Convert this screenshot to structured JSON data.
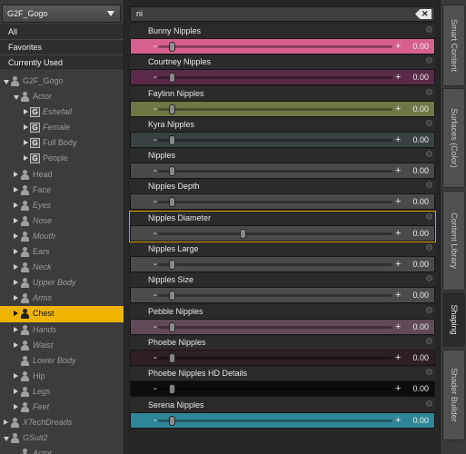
{
  "figure_selector": {
    "value": "G2F_Gogo"
  },
  "filters": [
    "All",
    "Favorites",
    "Currently Used"
  ],
  "tree": [
    {
      "label": "G2F_Gogo",
      "depth": 0,
      "icon": "person-icon",
      "expander": "down",
      "style": "dim"
    },
    {
      "label": "Actor",
      "depth": 1,
      "icon": "person-icon",
      "expander": "down",
      "style": "dim"
    },
    {
      "label": "Eshefail",
      "depth": 2,
      "icon": "group-icon",
      "expander": "right",
      "style": "ital"
    },
    {
      "label": "Female",
      "depth": 2,
      "icon": "group-icon",
      "expander": "right",
      "style": "ital"
    },
    {
      "label": "Full Body",
      "depth": 2,
      "icon": "group-icon",
      "expander": "right",
      "style": "dim"
    },
    {
      "label": "People",
      "depth": 2,
      "icon": "group-icon",
      "expander": "right",
      "style": "dim"
    },
    {
      "label": "Head",
      "depth": 1,
      "icon": "person-icon",
      "expander": "right",
      "style": "dim"
    },
    {
      "label": "Face",
      "depth": 1,
      "icon": "person-icon",
      "expander": "right",
      "style": "dim"
    },
    {
      "label": "Eyes",
      "depth": 1,
      "icon": "person-icon",
      "expander": "right",
      "style": "ital"
    },
    {
      "label": "Nose",
      "depth": 1,
      "icon": "person-icon",
      "expander": "right",
      "style": "ital"
    },
    {
      "label": "Mouth",
      "depth": 1,
      "icon": "person-icon",
      "expander": "right",
      "style": "ital"
    },
    {
      "label": "Ears",
      "depth": 1,
      "icon": "person-icon",
      "expander": "right",
      "style": "dim"
    },
    {
      "label": "Neck",
      "depth": 1,
      "icon": "person-icon",
      "expander": "right",
      "style": "ital"
    },
    {
      "label": "Upper Body",
      "depth": 1,
      "icon": "person-icon",
      "expander": "right",
      "style": "ital"
    },
    {
      "label": "Arms",
      "depth": 1,
      "icon": "person-icon",
      "expander": "right",
      "style": "ital"
    },
    {
      "label": "Chest",
      "depth": 1,
      "icon": "person-icon",
      "expander": "right",
      "style": "sel"
    },
    {
      "label": "Hands",
      "depth": 1,
      "icon": "person-icon",
      "expander": "right",
      "style": "ital"
    },
    {
      "label": "Waist",
      "depth": 1,
      "icon": "person-icon",
      "expander": "right",
      "style": "ital"
    },
    {
      "label": "Lower Body",
      "depth": 1,
      "icon": "person-icon",
      "expander": "",
      "style": "ital"
    },
    {
      "label": "Hip",
      "depth": 1,
      "icon": "person-icon",
      "expander": "right",
      "style": "dim"
    },
    {
      "label": "Legs",
      "depth": 1,
      "icon": "person-icon",
      "expander": "right",
      "style": "ital"
    },
    {
      "label": "Feet",
      "depth": 1,
      "icon": "person-icon",
      "expander": "right",
      "style": "ital"
    },
    {
      "label": "XTechDreads",
      "depth": 0,
      "icon": "person-icon",
      "expander": "right",
      "style": "ital"
    },
    {
      "label": "GSuit2",
      "depth": 0,
      "icon": "person-icon",
      "expander": "down",
      "style": "ital"
    },
    {
      "label": "Actor",
      "depth": 1,
      "icon": "person-icon",
      "expander": "",
      "style": "ital"
    }
  ],
  "search": {
    "value": "ni"
  },
  "sliders": [
    {
      "name": "Bunny Nipples",
      "value": "0.00",
      "color": "#d8608f",
      "knob": 0.06,
      "active": false
    },
    {
      "name": "Courtney Nipples",
      "value": "0.00",
      "color": "#5a2a48",
      "knob": 0.06,
      "active": false
    },
    {
      "name": "Faylinn Nipples",
      "value": "0.00",
      "color": "#6e7846",
      "knob": 0.06,
      "active": false
    },
    {
      "name": "Kyra Nipples",
      "value": "0.00",
      "color": "#3a4143",
      "knob": 0.06,
      "active": false
    },
    {
      "name": "Nipples",
      "value": "0.00",
      "color": "#4a4a4a",
      "knob": 0.06,
      "active": false
    },
    {
      "name": "Nipples Depth",
      "value": "0.00",
      "color": "#4a4a4a",
      "knob": 0.06,
      "active": false
    },
    {
      "name": "Nipples Diameter",
      "value": "0.00",
      "color": "#4a4a4a",
      "knob": 0.36,
      "active": true
    },
    {
      "name": "Nipples Large",
      "value": "0.00",
      "color": "#4a4a4a",
      "knob": 0.06,
      "active": false
    },
    {
      "name": "Nipples Size",
      "value": "0.00",
      "color": "#4c4c4c",
      "knob": 0.06,
      "active": false
    },
    {
      "name": "Pebble Nipples",
      "value": "0.00",
      "color": "#614a58",
      "knob": 0.06,
      "active": false
    },
    {
      "name": "Phoebe Nipples",
      "value": "0.00",
      "color": "#2e1f22",
      "knob": 0.06,
      "active": false
    },
    {
      "name": "Phoebe Nipples HD Details",
      "value": "0.00",
      "color": "#0c0c0c",
      "knob": 0.06,
      "active": false
    },
    {
      "name": "Serena Nipples",
      "value": "0.00",
      "color": "#2e8798",
      "knob": 0.06,
      "active": false
    }
  ],
  "tabs": [
    {
      "label": "Smart Content",
      "active": false
    },
    {
      "label": "Surfaces (Color)",
      "active": false
    },
    {
      "label": "Content Library",
      "active": false
    },
    {
      "label": "Shaping",
      "active": true
    },
    {
      "label": "Shader Builder",
      "active": false
    }
  ]
}
